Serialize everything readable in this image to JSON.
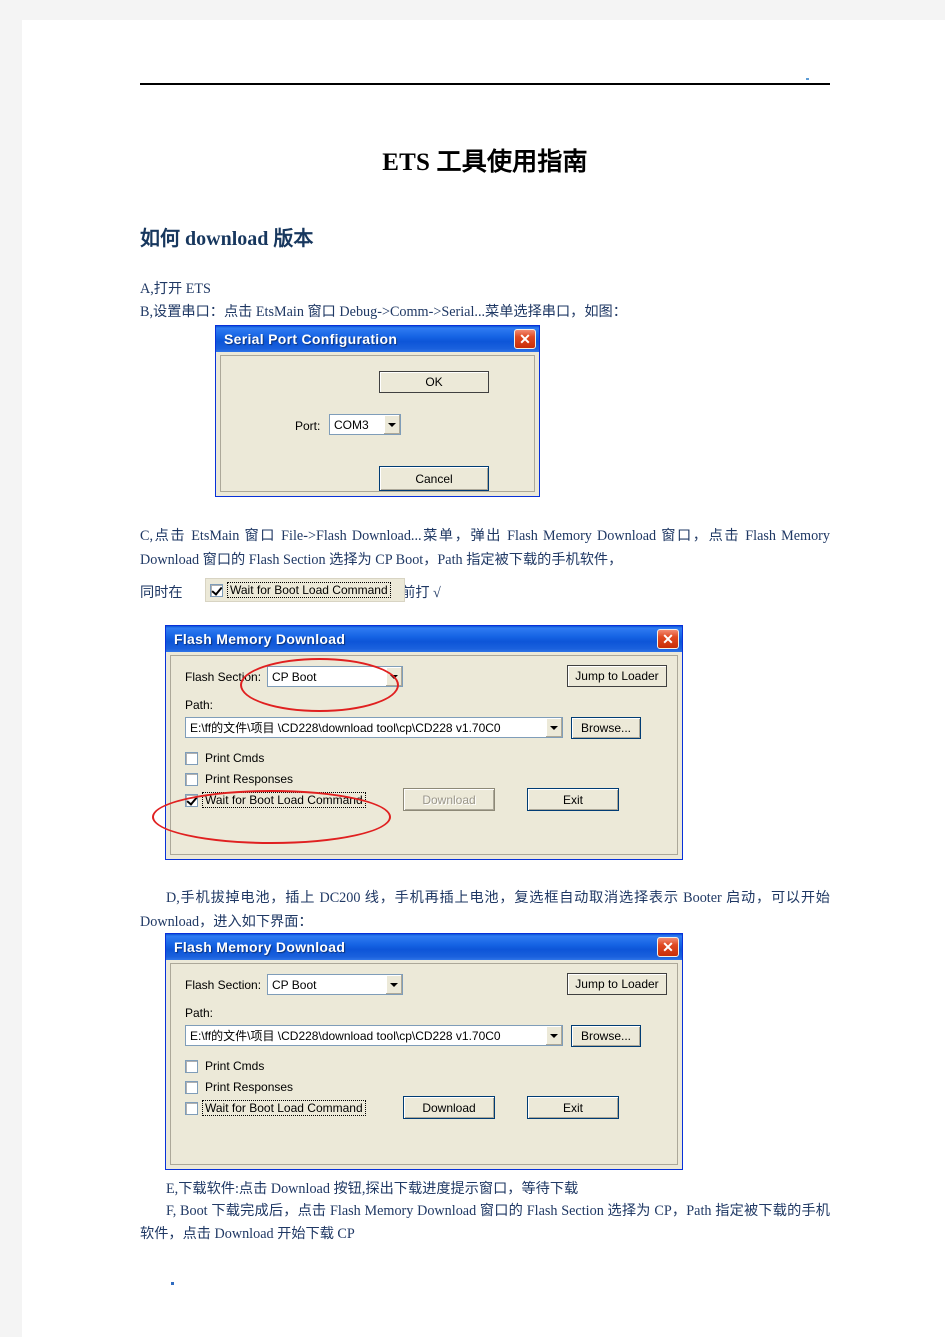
{
  "document": {
    "title_bold": "ETS",
    "title_rest": " 工具使用指南",
    "section_heading": "如何 download 版本",
    "para_a": "A,打开 ETS",
    "para_b": "B,设置串口：点击 EtsMain 窗口 Debug->Comm->Serial...菜单选择串口，如图：",
    "para_c": "C,点击 EtsMain 窗口 File->Flash Download...菜单，弹出 Flash Memory Download 窗口，点击 Flash Memory Download 窗口的 Flash Section 选择为 CP Boot，Path 指定被下载的手机软件，",
    "para_c_prefix": "同时在",
    "para_c_suffix": "前打 √",
    "para_d": "D,手机拔掉电池，插上 DC200 线，手机再插上电池，复选框自动取消选择表示 Booter 启动，可以开始 Download，进入如下界面：",
    "para_e": "E,下载软件:点击 Download 按钮,探出下载进度提示窗口，等待下载",
    "para_f": "F, Boot 下载完成后，点击 Flash Memory Download 窗口的 Flash Section 选择为 CP，Path 指定被下载的手机软件，点击 Download 开始下载 CP"
  },
  "serial_dialog": {
    "title": "Serial Port Configuration",
    "close_label": "✕",
    "ok_label": "OK",
    "cancel_label": "Cancel",
    "port_label": "Port:",
    "port_value": "COM3"
  },
  "flash_dialog_1": {
    "title": "Flash Memory Download",
    "close_label": "✕",
    "flash_section_label": "Flash Section:",
    "flash_section_value": "CP Boot",
    "jump_label": "Jump to Loader",
    "path_label": "Path:",
    "path_value": "E:\\ff的文件\\项目 \\CD228\\download tool\\cp\\CD228 v1.70C0",
    "browse_label": "Browse...",
    "print_cmds_label": "Print Cmds",
    "print_cmds_checked": false,
    "print_responses_label": "Print Responses",
    "print_responses_checked": false,
    "wait_boot_label": "Wait for Boot Load Command",
    "wait_boot_checked": true,
    "download_label": "Download",
    "download_enabled": false,
    "exit_label": "Exit"
  },
  "flash_dialog_2": {
    "title": "Flash Memory Download",
    "close_label": "✕",
    "flash_section_label": "Flash Section:",
    "flash_section_value": "CP Boot",
    "jump_label": "Jump to Loader",
    "path_label": "Path:",
    "path_value": "E:\\ff的文件\\项目 \\CD228\\download tool\\cp\\CD228 v1.70C0",
    "browse_label": "Browse...",
    "print_cmds_label": "Print Cmds",
    "print_cmds_checked": false,
    "print_responses_label": "Print Responses",
    "print_responses_checked": false,
    "wait_boot_label": "Wait for Boot Load Command",
    "wait_boot_checked": false,
    "download_label": "Download",
    "download_enabled": true,
    "exit_label": "Exit"
  },
  "snippet": {
    "label": "Wait for Boot Load Command",
    "checked": true
  },
  "colors": {
    "annotation": "#e02020",
    "title_bar": "#1664e4",
    "heading": "#17375e"
  }
}
